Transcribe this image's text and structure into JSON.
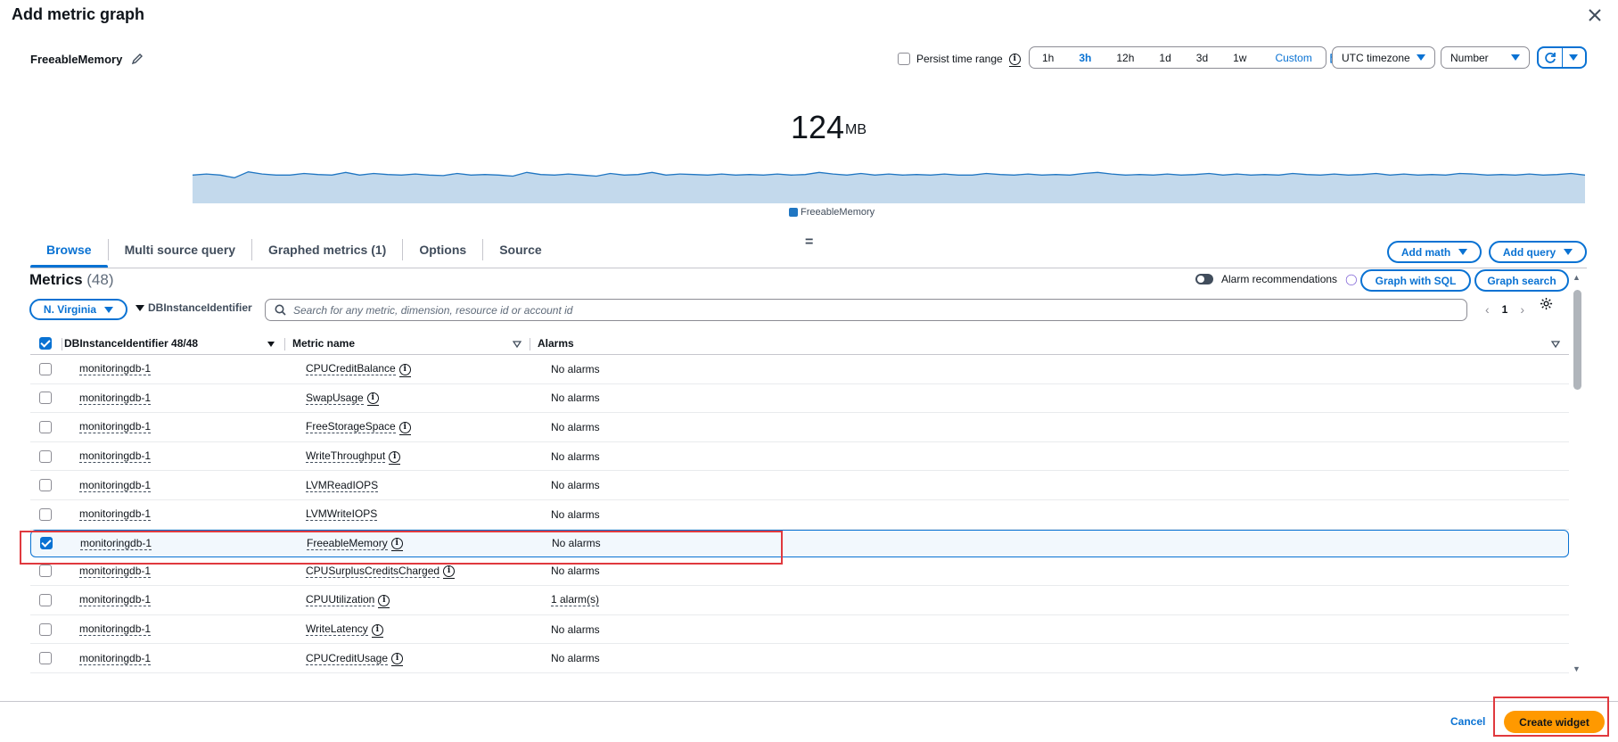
{
  "dialog": {
    "title": "Add metric graph",
    "close_icon": "close-icon"
  },
  "header": {
    "metric_title": "FreeableMemory",
    "persist_label": "Persist time range",
    "persist_checked": false,
    "time_ranges": [
      "1h",
      "3h",
      "12h",
      "1d",
      "3d",
      "1w"
    ],
    "active_time_range": "3h",
    "custom_label": "Custom",
    "timezone": "UTC timezone",
    "display_type": "Number"
  },
  "graph": {
    "value": "124",
    "unit": "MB",
    "legend": "FreeableMemory",
    "series_color": "#2076c2",
    "fill_color": "#c3d9ec",
    "relative_levels": [
      0.5,
      0.52,
      0.5,
      0.45,
      0.56,
      0.52,
      0.5,
      0.5,
      0.53,
      0.51,
      0.5,
      0.55,
      0.5,
      0.53,
      0.51,
      0.5,
      0.52,
      0.5,
      0.49,
      0.53,
      0.5,
      0.51,
      0.5,
      0.48,
      0.55,
      0.51,
      0.5,
      0.52,
      0.5,
      0.48,
      0.53,
      0.5,
      0.51,
      0.55,
      0.5,
      0.52,
      0.51,
      0.5,
      0.52,
      0.5,
      0.51,
      0.5,
      0.52,
      0.5,
      0.51,
      0.55,
      0.52,
      0.5,
      0.53,
      0.5,
      0.52,
      0.5,
      0.51,
      0.5,
      0.52,
      0.5,
      0.5,
      0.53,
      0.51,
      0.5,
      0.52,
      0.5,
      0.51,
      0.5,
      0.53,
      0.55,
      0.52,
      0.5,
      0.51,
      0.5,
      0.52,
      0.5,
      0.51,
      0.53,
      0.5,
      0.52,
      0.5,
      0.51,
      0.5,
      0.53,
      0.51,
      0.5,
      0.52,
      0.5,
      0.51,
      0.53,
      0.5,
      0.52,
      0.5,
      0.51,
      0.5,
      0.53,
      0.52,
      0.5,
      0.51,
      0.5,
      0.52,
      0.5,
      0.51,
      0.53,
      0.5
    ]
  },
  "tabs": [
    {
      "label": "Browse",
      "active": true
    },
    {
      "label": "Multi source query",
      "active": false
    },
    {
      "label": "Graphed metrics (1)",
      "active": false
    },
    {
      "label": "Options",
      "active": false
    },
    {
      "label": "Source",
      "active": false
    }
  ],
  "actions": {
    "add_math": "Add math",
    "add_query": "Add query",
    "graph_with_sql": "Graph with SQL",
    "graph_search": "Graph search",
    "alarm_recommendations": "Alarm recommendations"
  },
  "metrics": {
    "title": "Metrics",
    "count": "(48)",
    "region": "N. Virginia",
    "dimension_filter": "DBInstanceIdentifier",
    "search_placeholder": "Search for any metric, dimension, resource id or account id",
    "page": "1",
    "columns": {
      "instance": "DBInstanceIdentifier 48/48",
      "metric": "Metric name",
      "alarms": "Alarms"
    },
    "rows": [
      {
        "instance": "monitoringdb-1",
        "metric": "CPUCreditBalance",
        "info": true,
        "alarms": "No alarms",
        "checked": false
      },
      {
        "instance": "monitoringdb-1",
        "metric": "SwapUsage",
        "info": true,
        "alarms": "No alarms",
        "checked": false
      },
      {
        "instance": "monitoringdb-1",
        "metric": "FreeStorageSpace",
        "info": true,
        "alarms": "No alarms",
        "checked": false
      },
      {
        "instance": "monitoringdb-1",
        "metric": "WriteThroughput",
        "info": true,
        "alarms": "No alarms",
        "checked": false
      },
      {
        "instance": "monitoringdb-1",
        "metric": "LVMReadIOPS",
        "info": false,
        "alarms": "No alarms",
        "checked": false
      },
      {
        "instance": "monitoringdb-1",
        "metric": "LVMWriteIOPS",
        "info": false,
        "alarms": "No alarms",
        "checked": false
      },
      {
        "instance": "monitoringdb-1",
        "metric": "FreeableMemory",
        "info": true,
        "alarms": "No alarms",
        "checked": true
      },
      {
        "instance": "monitoringdb-1",
        "metric": "CPUSurplusCreditsCharged",
        "info": true,
        "alarms": "No alarms",
        "checked": false
      },
      {
        "instance": "monitoringdb-1",
        "metric": "CPUUtilization",
        "info": true,
        "alarms": "1 alarm(s)",
        "checked": false
      },
      {
        "instance": "monitoringdb-1",
        "metric": "WriteLatency",
        "info": true,
        "alarms": "No alarms",
        "checked": false
      },
      {
        "instance": "monitoringdb-1",
        "metric": "CPUCreditUsage",
        "info": true,
        "alarms": "No alarms",
        "checked": false
      }
    ]
  },
  "footer": {
    "cancel": "Cancel",
    "create": "Create widget"
  },
  "colors": {
    "accent": "#0972d3",
    "primary_button": "#ff9900",
    "highlight": "#e0393e"
  }
}
